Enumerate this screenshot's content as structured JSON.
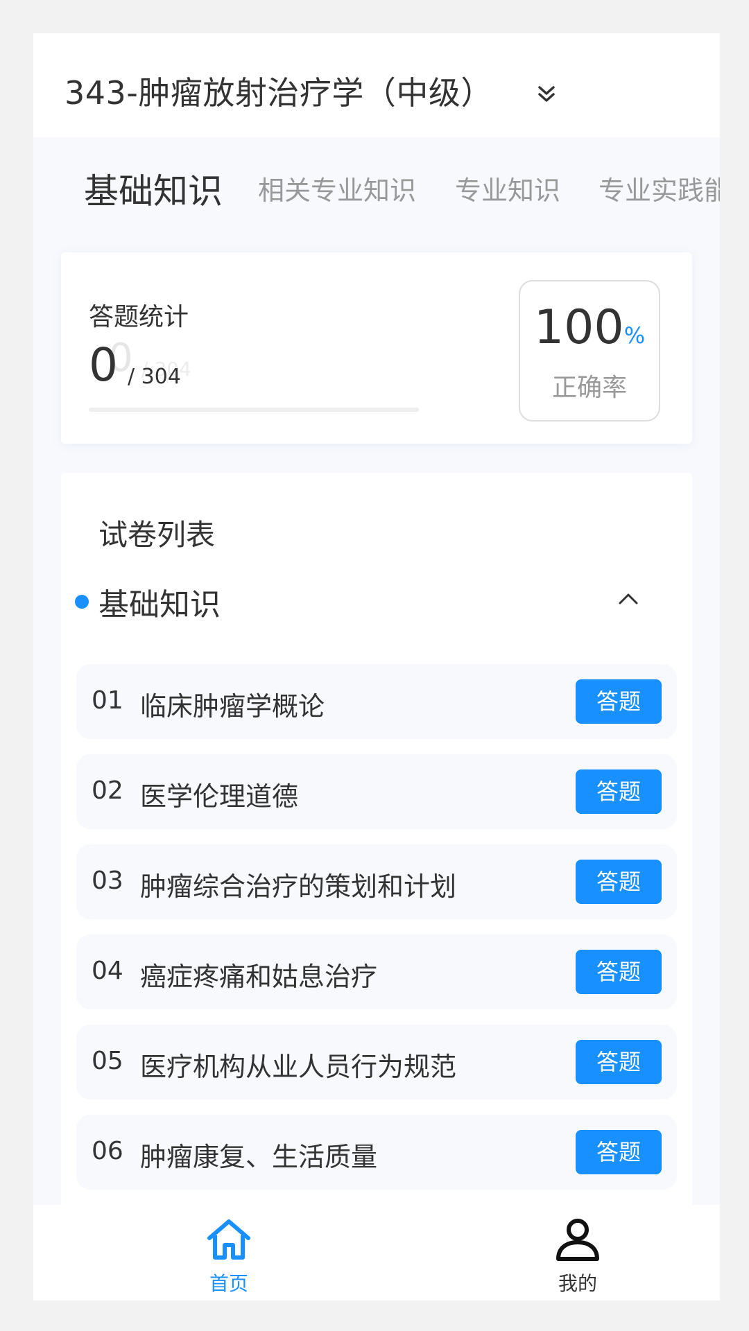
{
  "header": {
    "title": "343-肿瘤放射治疗学（中级）",
    "chevron_icon": "double-chevron-down-icon"
  },
  "tabs": [
    {
      "label": "基础知识",
      "active": true
    },
    {
      "label": "相关专业知识",
      "active": false
    },
    {
      "label": "专业知识",
      "active": false
    },
    {
      "label": "专业实践能",
      "active": false
    }
  ],
  "stats": {
    "title": "答题统计",
    "answered": "0",
    "total": "/ 304",
    "ghost_answered": "0",
    "ghost_total": "/ 304",
    "progress_fraction": 0,
    "rate_value": "100",
    "rate_unit": "%",
    "rate_label": "正确率"
  },
  "list": {
    "title": "试卷列表",
    "section_label": "基础知识",
    "section_toggle_icon": "chevron-up-icon",
    "items": [
      {
        "num": "01",
        "name": "临床肿瘤学概论",
        "button": "答题"
      },
      {
        "num": "02",
        "name": "医学伦理道德",
        "button": "答题"
      },
      {
        "num": "03",
        "name": "肿瘤综合治疗的策划和计划",
        "button": "答题"
      },
      {
        "num": "04",
        "name": "癌症疼痛和姑息治疗",
        "button": "答题"
      },
      {
        "num": "05",
        "name": "医疗机构从业人员行为规范",
        "button": "答题"
      },
      {
        "num": "06",
        "name": "肿瘤康复、生活质量",
        "button": "答题"
      }
    ]
  },
  "nav": {
    "home_label": "首页",
    "home_icon": "home-icon",
    "mine_label": "我的",
    "mine_icon": "user-icon",
    "active_color": "#1890ff",
    "inactive_color": "#333333"
  },
  "colors": {
    "accent": "#1890ff",
    "text": "#333333",
    "muted": "#999999"
  }
}
